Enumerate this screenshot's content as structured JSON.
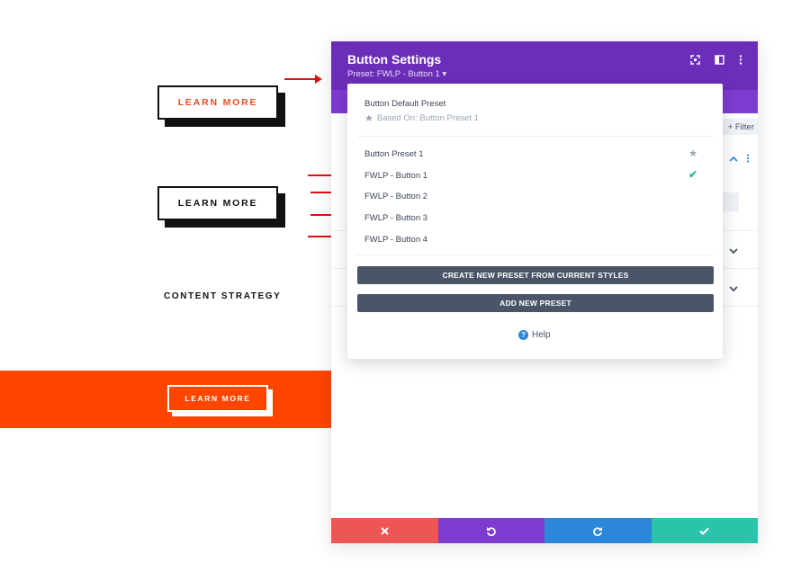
{
  "canvas": {
    "button1_label": "LEARN MORE",
    "button2_label": "LEARN MORE",
    "content_strategy": "CONTENT STRATEGY",
    "button3_label": "LEARN MORE"
  },
  "modal": {
    "title": "Button Settings",
    "preset_line": "Preset: FWLP - Button 1 ▾",
    "filter_label": "+ Filter"
  },
  "dropdown": {
    "default_preset": "Button Default Preset",
    "based_on": "Based On: Button Preset 1",
    "items": [
      {
        "label": "Button Preset 1"
      },
      {
        "label": "FWLP - Button 1"
      },
      {
        "label": "FWLP - Button 2"
      },
      {
        "label": "FWLP - Button 3"
      },
      {
        "label": "FWLP - Button 4"
      }
    ],
    "create_btn": "CREATE NEW PRESET FROM CURRENT STYLES",
    "add_btn": "ADD NEW PRESET",
    "help_label": "Help"
  },
  "icons": {
    "header": [
      "fullscreen-icon",
      "split-view-icon",
      "more-options-icon"
    ],
    "footer": [
      "close-icon",
      "undo-icon",
      "redo-icon",
      "check-icon"
    ]
  },
  "colors": {
    "header": "#6c2eb9",
    "tabs": "#7e3bd0",
    "accent_orange": "#ff4500",
    "footer_close": "#ef5555",
    "footer_undo": "#7e3bd0",
    "footer_redo": "#2b87da",
    "footer_save": "#29c4a9"
  }
}
